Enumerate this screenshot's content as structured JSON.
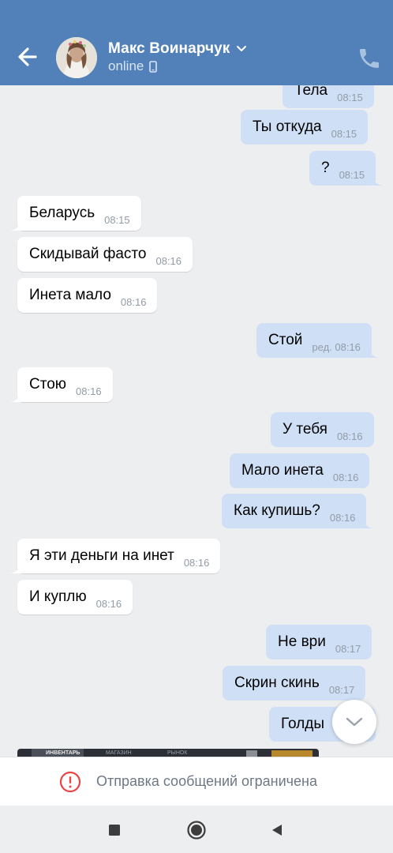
{
  "header": {
    "contact_name": "Макс Воинарчук",
    "status": "online",
    "back_icon": "arrow-left-icon",
    "call_icon": "phone-icon",
    "colors": {
      "bar": "#5181b8",
      "bubble_out": "#cfe0f6",
      "bubble_in": "#ffffff",
      "background": "#edeef0"
    }
  },
  "messages": [
    {
      "dir": "out",
      "text": "Тела",
      "time": "08:15"
    },
    {
      "dir": "out",
      "text": "Ты откуда",
      "time": "08:15"
    },
    {
      "dir": "out",
      "text": "?",
      "time": "08:15"
    },
    {
      "dir": "in",
      "text": "Беларусь",
      "time": "08:15"
    },
    {
      "dir": "in",
      "text": "Скидывай фасто",
      "time": "08:16"
    },
    {
      "dir": "in",
      "text": "Инета мало",
      "time": "08:16"
    },
    {
      "dir": "out",
      "text": "Стой",
      "time": "ред. 08:16"
    },
    {
      "dir": "in",
      "text": "Стою",
      "time": "08:16"
    },
    {
      "dir": "out",
      "text": "У тебя",
      "time": "08:16"
    },
    {
      "dir": "out",
      "text": "Мало инета",
      "time": "08:16"
    },
    {
      "dir": "out",
      "text": "Как купишь?",
      "time": "08:16"
    },
    {
      "dir": "in",
      "text": "Я эти деньги на инет",
      "time": "08:16"
    },
    {
      "dir": "in",
      "text": "И куплю",
      "time": "08:16"
    },
    {
      "dir": "out",
      "text": "Не ври",
      "time": "08:17"
    },
    {
      "dir": "out",
      "text": "Скрин скинь",
      "time": "08:17"
    },
    {
      "dir": "out",
      "text": "Голды",
      "time": ""
    }
  ],
  "image_preview": {
    "labels": [
      "ИНВЕНТАРЬ",
      "МАГАЗИН",
      "РЫНОК"
    ]
  },
  "footer": {
    "restriction_text": "Отправка сообщений ограничена",
    "warning_icon": "warning-circle-icon"
  },
  "navbar": {
    "icons": [
      "recents-icon",
      "home-icon",
      "back-triangle-icon"
    ]
  }
}
